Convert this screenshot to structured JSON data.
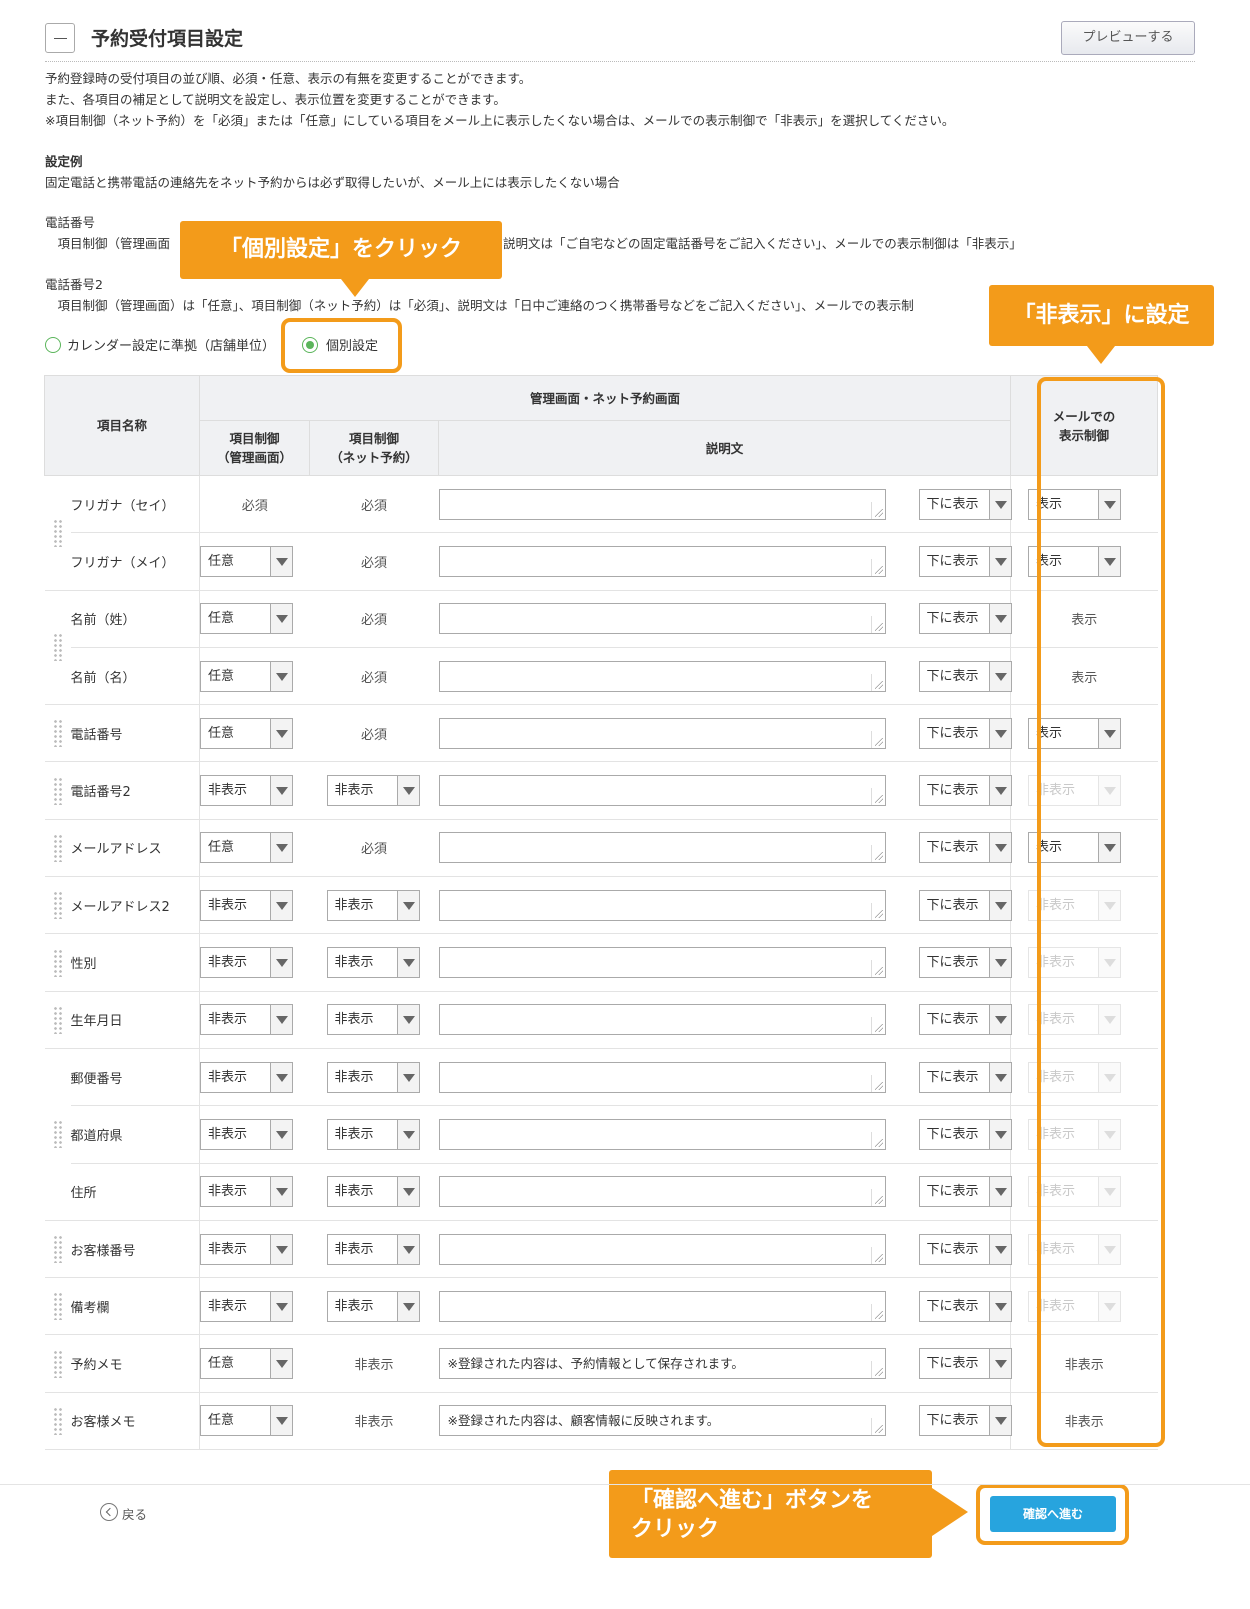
{
  "header": {
    "title": "予約受付項目設定",
    "preview_label": "プレビューする"
  },
  "description": {
    "line1": "予約登録時の受付項目の並び順、必須・任意、表示の有無を変更することができます。",
    "line2": "また、各項目の補足として説明文を設定し、表示位置を変更することができます。",
    "line3": "※項目制御（ネット予約）を「必須」または「任意」にしている項目をメール上に表示したくない場合は、メールでの表示制御で「非表示」を選択してください。",
    "example_heading": "設定例",
    "example_line": "固定電話と携帯電話の連絡先をネット予約からは必ず取得したいが、メール上には表示したくない場合",
    "phone_heading": "電話番号",
    "phone_line_left": "　項目制御（管理画面",
    "phone_line_right": "説明文は「ご自宅などの固定電話番号をご記入ください」、メールでの表示制御は「非表示」",
    "phone2_heading": "電話番号2",
    "phone2_line": "　項目制御（管理画面）は「任意」、項目制御（ネット予約）は「必須」、説明文は「日中ご連絡のつく携帯番号などをご記入ください」、メールでの表示制"
  },
  "radio": {
    "option1": "カレンダー設定に準拠（店舗単位）",
    "option2": "個別設定"
  },
  "callouts": {
    "click_individual": "「個別設定」をクリック",
    "set_hidden": "「非表示」に設定",
    "click_confirm_line1": "「確認へ進む」ボタンを",
    "click_confirm_line2": "クリック"
  },
  "table": {
    "header_name": "項目名称",
    "header_group": "管理画面・ネット予約画面",
    "header_admin_line1": "項目制御",
    "header_admin_line2": "（管理画面）",
    "header_net_line1": "項目制御",
    "header_net_line2": "（ネット予約）",
    "header_desc": "説明文",
    "header_mail_line1": "メールでの",
    "header_mail_line2": "表示制御",
    "position_value": "下に表示",
    "rows": [
      {
        "name": "フリガナ（セイ）",
        "admin": "必須",
        "net": "必須",
        "desc": "",
        "mail": "表示"
      },
      {
        "name": "フリガナ（メイ）",
        "admin": "任意",
        "net": "必須",
        "desc": "",
        "mail": "表示"
      },
      {
        "name": "名前（姓）",
        "admin": "任意",
        "net": "必須",
        "desc": "",
        "mail": "表示"
      },
      {
        "name": "名前（名）",
        "admin": "任意",
        "net": "必須",
        "desc": "",
        "mail": "表示"
      },
      {
        "name": "電話番号",
        "admin": "任意",
        "net": "必須",
        "desc": "",
        "mail": "表示"
      },
      {
        "name": "電話番号2",
        "admin": "非表示",
        "net": "非表示",
        "desc": "",
        "mail": "非表示"
      },
      {
        "name": "メールアドレス",
        "admin": "任意",
        "net": "必須",
        "desc": "",
        "mail": "表示"
      },
      {
        "name": "メールアドレス2",
        "admin": "非表示",
        "net": "非表示",
        "desc": "",
        "mail": "非表示"
      },
      {
        "name": "性別",
        "admin": "非表示",
        "net": "非表示",
        "desc": "",
        "mail": "非表示"
      },
      {
        "name": "生年月日",
        "admin": "非表示",
        "net": "非表示",
        "desc": "",
        "mail": "非表示"
      },
      {
        "name": "郵便番号",
        "admin": "非表示",
        "net": "非表示",
        "desc": "",
        "mail": "非表示"
      },
      {
        "name": "都道府県",
        "admin": "非表示",
        "net": "非表示",
        "desc": "",
        "mail": "非表示"
      },
      {
        "name": "住所",
        "admin": "非表示",
        "net": "非表示",
        "desc": "",
        "mail": "非表示"
      },
      {
        "name": "お客様番号",
        "admin": "非表示",
        "net": "非表示",
        "desc": "",
        "mail": "非表示"
      },
      {
        "name": "備考欄",
        "admin": "非表示",
        "net": "非表示",
        "desc": "",
        "mail": "非表示"
      },
      {
        "name": "予約メモ",
        "admin": "任意",
        "net": "非表示",
        "desc": "※登録された内容は、予約情報として保存されます。",
        "mail": "非表示"
      },
      {
        "name": "お客様メモ",
        "admin": "任意",
        "net": "非表示",
        "desc": "※登録された内容は、顧客情報に反映されます。",
        "mail": "非表示"
      }
    ]
  },
  "footer": {
    "back_label": "戻る",
    "confirm_label": "確認へ進む"
  },
  "colors": {
    "accent_orange": "#f39b1a",
    "confirm_blue": "#27a4de",
    "radio_green": "#5bb55b"
  }
}
